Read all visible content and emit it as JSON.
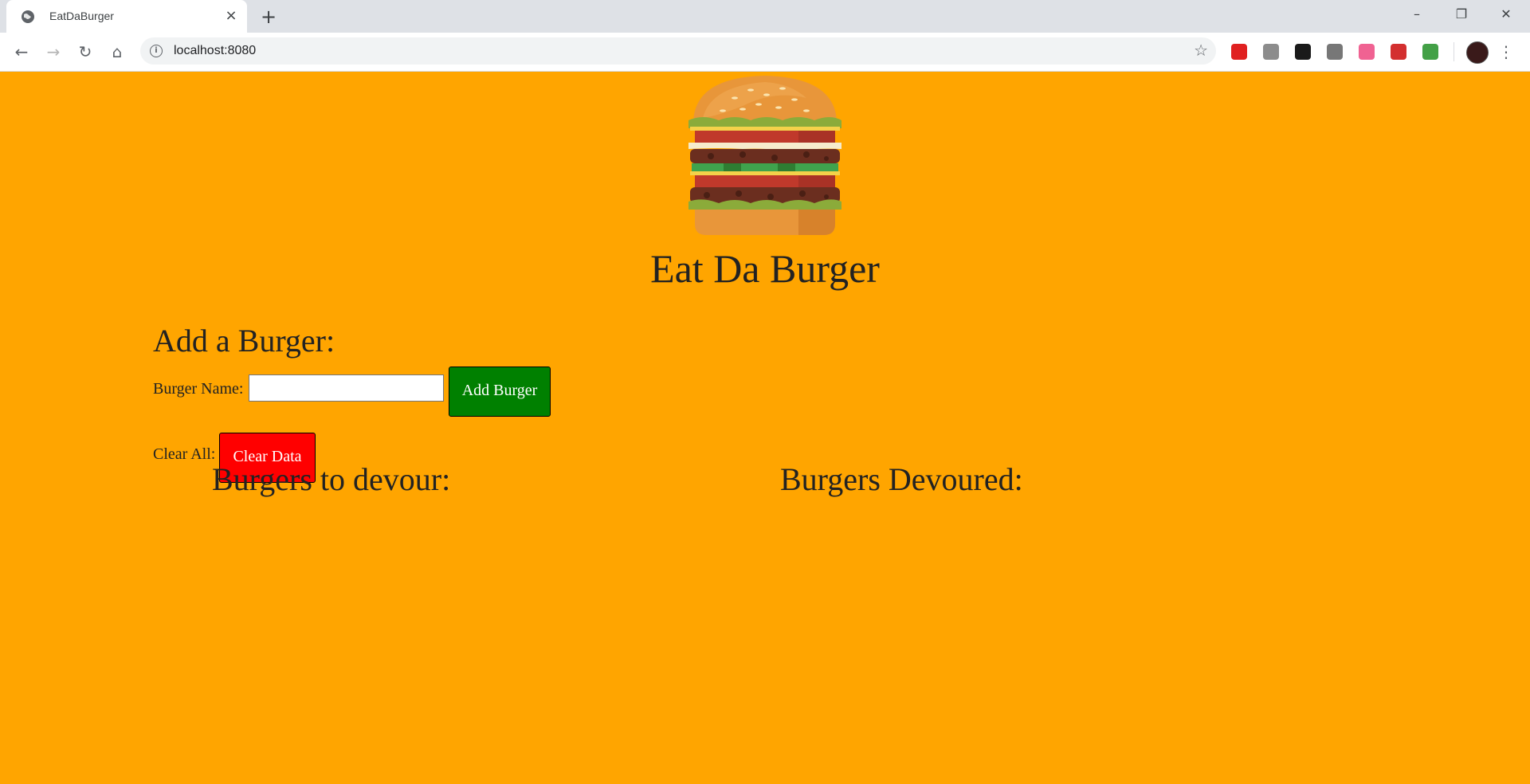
{
  "browser": {
    "tab_title": "EatDaBurger",
    "url": "localhost:8080",
    "window_controls": {
      "minimize": "–",
      "restore": "❐",
      "close": "✕"
    },
    "extensions": [
      {
        "name": "adblock-icon",
        "color": "#e02020"
      },
      {
        "name": "drive-icon",
        "color": "#8c8c8c"
      },
      {
        "name": "blackberry-icon",
        "color": "#1a1a1a"
      },
      {
        "name": "extension-gray-icon",
        "color": "#777777"
      },
      {
        "name": "cast-pink-icon",
        "color": "#f06292"
      },
      {
        "name": "pocket-icon",
        "color": "#d32f2f"
      },
      {
        "name": "colorful-extension-icon",
        "color": "#43a047"
      }
    ]
  },
  "page": {
    "background": "#ffa500",
    "logo": "burger-logo-icon",
    "title": "Eat Da Burger",
    "add_section_title": "Add a Burger:",
    "burger_name_label": "Burger Name:",
    "burger_name_value": "",
    "add_button": "Add Burger",
    "clear_label": "Clear All:",
    "clear_button": "Clear Data",
    "to_devour_title": "Burgers to devour:",
    "devoured_title": "Burgers Devoured:",
    "colors": {
      "add_button": "#008000",
      "clear_button": "#ff0000",
      "text": "#222222"
    }
  }
}
